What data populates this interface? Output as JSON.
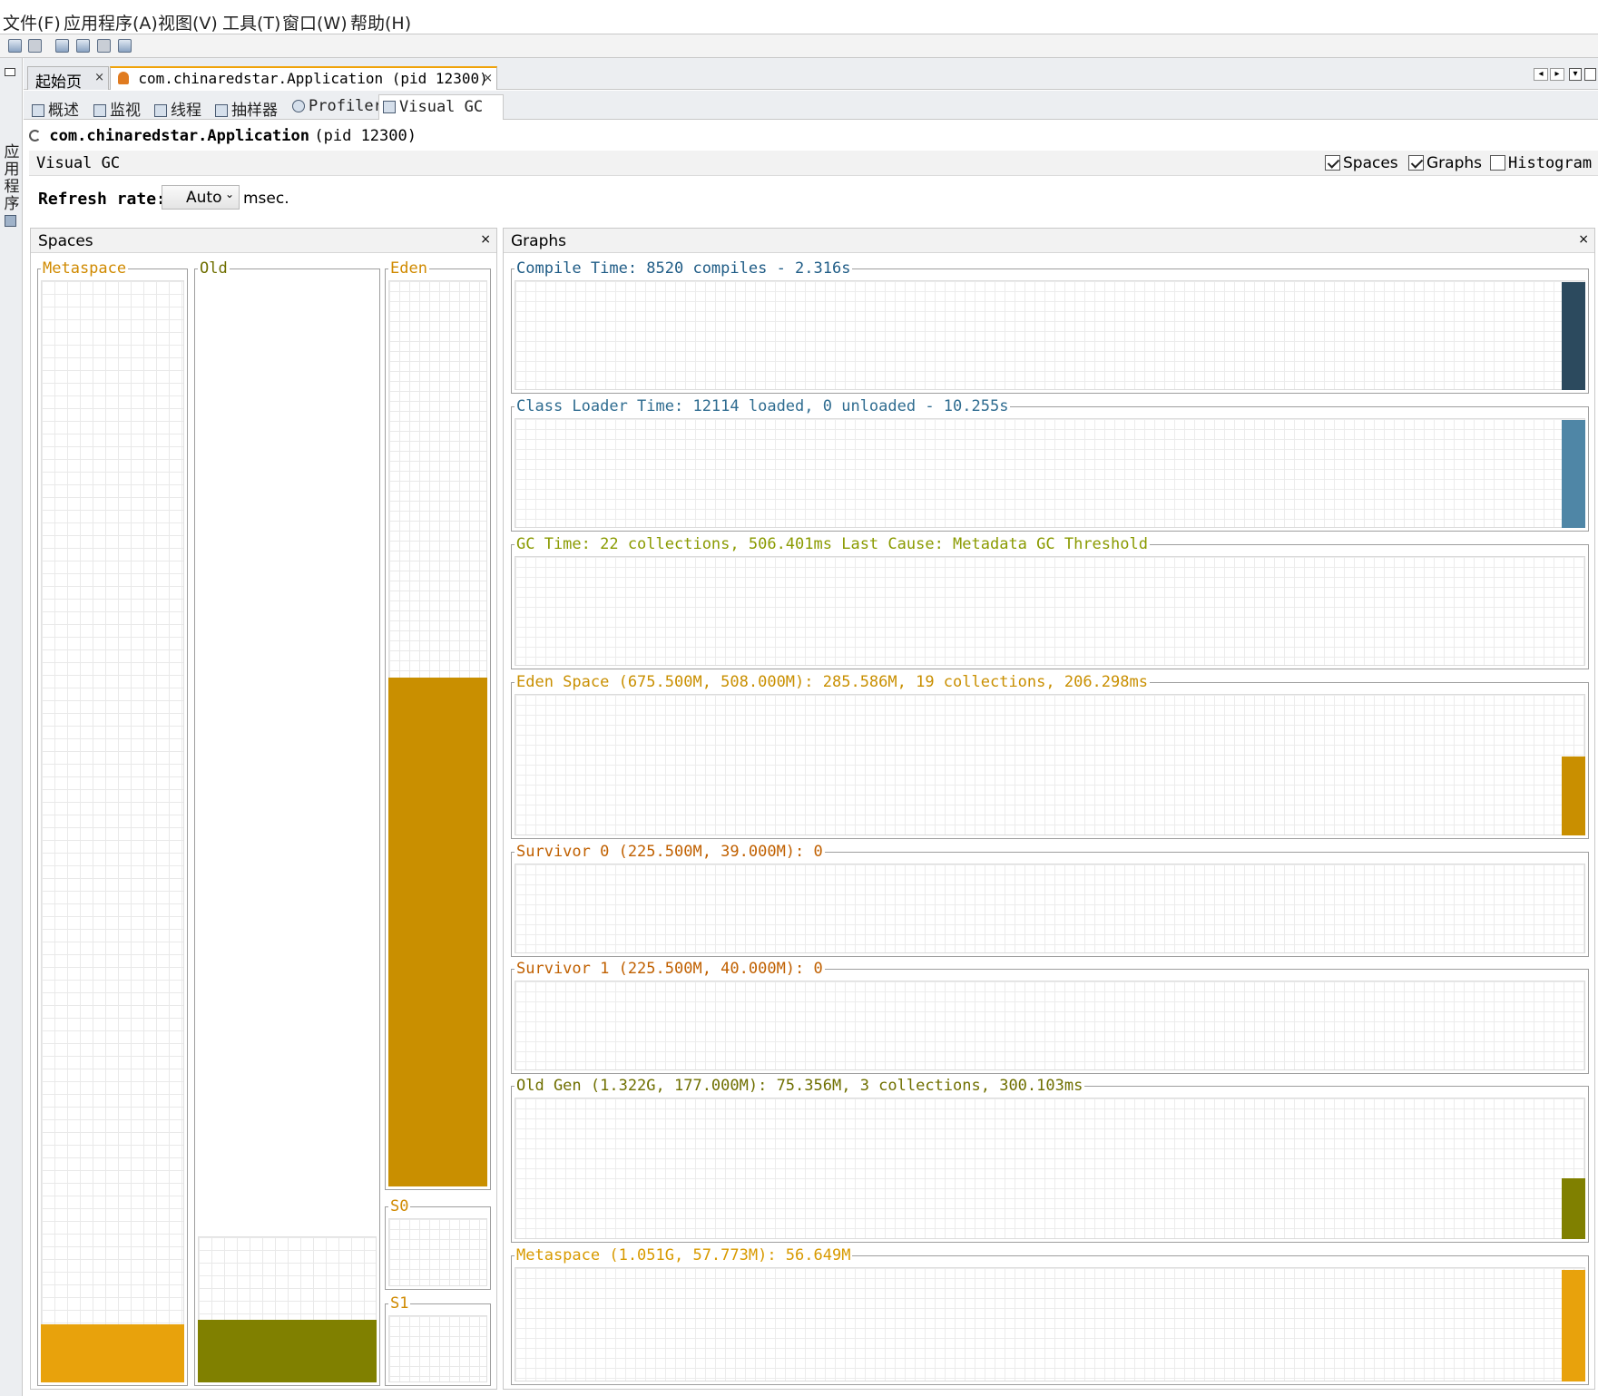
{
  "menu": [
    "文件(F)",
    "应用程序(A)",
    "视图(V)",
    "工具(T)",
    "窗口(W)",
    "帮助(H)"
  ],
  "left_strip": {
    "label": "应用程序"
  },
  "doc_tabs": [
    {
      "label": "起始页",
      "close": "×"
    },
    {
      "label": "com.chinaredstar.Application (pid 12300)",
      "close": "×"
    }
  ],
  "sub_tabs": [
    "概述",
    "监视",
    "线程",
    "抽样器",
    "Profiler",
    "Visual GC"
  ],
  "app": {
    "name": "com.chinaredstar.Application",
    "pid": "(pid 12300)"
  },
  "visual_gc": {
    "title": "Visual GC",
    "options": [
      {
        "label": "Spaces",
        "checked": true
      },
      {
        "label": "Graphs",
        "checked": true
      },
      {
        "label": "Histogram",
        "checked": false
      }
    ],
    "refresh_label": "Refresh rate:",
    "refresh_value": "Auto",
    "refresh_unit": "msec."
  },
  "spaces": {
    "title": "Spaces",
    "close": "×",
    "items": [
      {
        "label": "Metaspace",
        "fill": 0.053,
        "color": "#e8a20c"
      },
      {
        "label": "Old",
        "fill": 0.057,
        "color": "#808000"
      },
      {
        "label": "Eden",
        "fill": 0.562,
        "color": "#c98f00"
      },
      {
        "label": "S0",
        "fill": 0.0,
        "color": "#c98f00"
      },
      {
        "label": "S1",
        "fill": 0.0,
        "color": "#c98f00"
      }
    ]
  },
  "graphs": {
    "title": "Graphs",
    "close": "×",
    "items": [
      {
        "label": "Compile Time: 8520 compiles - 2.316s",
        "color": "#1f5c86",
        "bar_color": "#2c4a5e",
        "level": 0.98
      },
      {
        "label": "Class Loader Time: 12114 loaded, 0 unloaded - 10.255s",
        "color": "#2f6c90",
        "bar_color": "#4f86a6",
        "level": 0.98
      },
      {
        "label": "GC Time: 22 collections, 506.401ms Last Cause: Metadata GC Threshold",
        "color": "#8a9a00",
        "bar_color": "#8a9a00",
        "level": 0.0
      },
      {
        "label": "Eden Space (675.500M, 508.000M): 285.586M, 19 collections, 206.298ms",
        "color": "#c98f00",
        "bar_color": "#c98f00",
        "level": 0.56
      },
      {
        "label": "Survivor 0 (225.500M, 39.000M): 0",
        "color": "#c06000",
        "bar_color": "#c06000",
        "level": 0.0
      },
      {
        "label": "Survivor 1 (225.500M, 40.000M): 0",
        "color": "#c06000",
        "bar_color": "#c06000",
        "level": 0.0
      },
      {
        "label": "Old Gen (1.322G, 177.000M): 75.356M, 3 collections, 300.103ms",
        "color": "#6f6f00",
        "bar_color": "#808000",
        "level": 0.43
      },
      {
        "label": "Metaspace (1.051G, 57.773M): 56.649M",
        "color": "#d89a00",
        "bar_color": "#e8a20c",
        "level": 0.98
      }
    ]
  }
}
